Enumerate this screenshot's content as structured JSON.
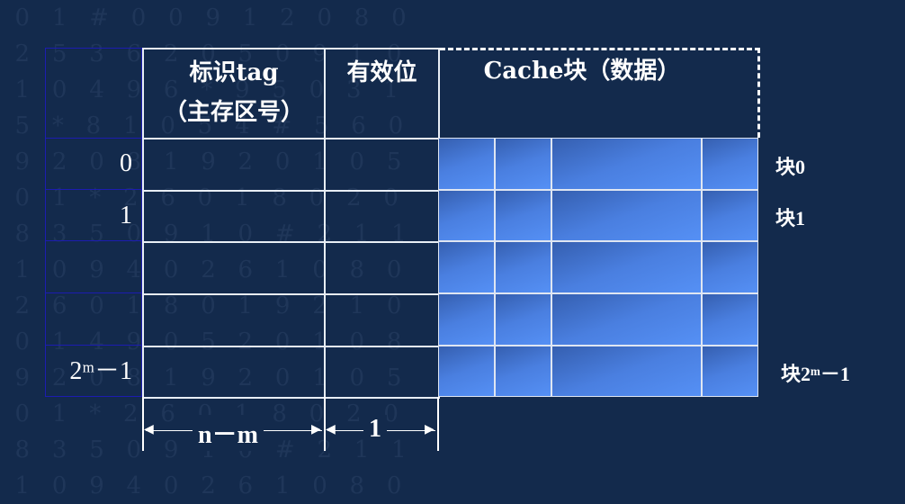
{
  "header": {
    "tag_line1": "标识tag",
    "tag_line2": "（主存区号）",
    "valid": "有效位",
    "cache_block": "Cache块（数据）"
  },
  "row_numbers": [
    "0",
    "1",
    "",
    "",
    "2ᵐ－1"
  ],
  "block_labels": [
    "块0",
    "块1",
    "块2ᵐ－1"
  ],
  "dimensions": {
    "tag_width": "n－m",
    "valid_width": "1"
  },
  "colors": {
    "background": "#132a4c",
    "block_fill": "#4a7fe0"
  }
}
